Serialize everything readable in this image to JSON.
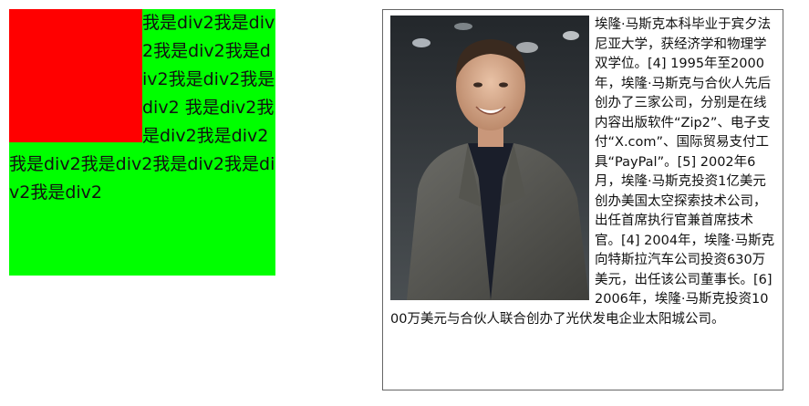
{
  "left_demo": {
    "text": "我是div2我是div2我是div2我是div2我是div2我是div2 我是div2我是div2我是div2我是div2我是div2我是div2我是div2我是div2"
  },
  "right_demo": {
    "image_alt": "Elon Musk",
    "text": "埃隆·马斯克本科毕业于宾夕法尼亚大学，获经济学和物理学双学位。[4] 1995年至2000年，埃隆·马斯克与合伙人先后创办了三家公司，分别是在线内容出版软件“Zip2”、电子支付“X.com”、国际贸易支付工具“PayPal”。[5] 2002年6月，埃隆·马斯克投资1亿美元创办美国太空探索技术公司，出任首席执行官兼首席技术官。[4] 2004年，埃隆·马斯克向特斯拉汽车公司投资630万美元，出任该公司董事长。[6] 2006年，埃隆·马斯克投资1000万美元与合伙人联合创办了光伏发电企业太阳城公司。"
  }
}
